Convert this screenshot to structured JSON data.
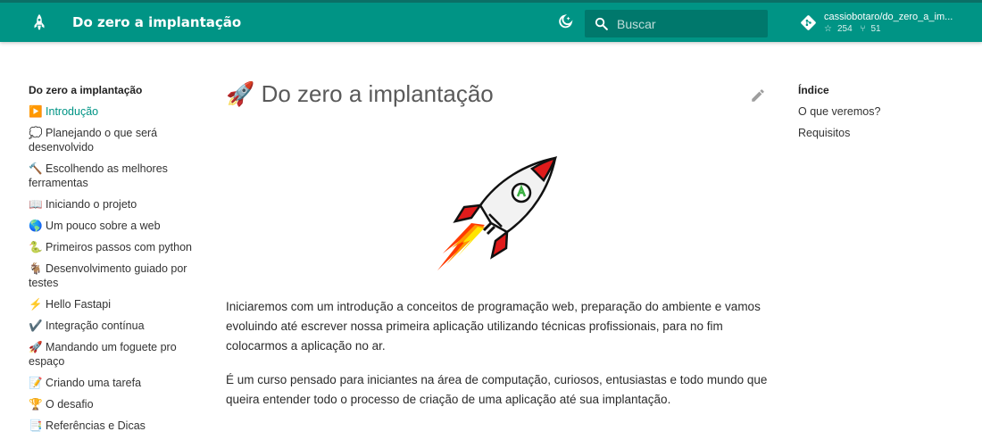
{
  "header": {
    "site_title": "Do zero a implantação",
    "theme_toggle_icon": "theme-toggle-icon",
    "search_placeholder": "Buscar",
    "repo": {
      "name": "cassiobotaro/do_zero_a_im...",
      "stars": "254",
      "forks": "51"
    }
  },
  "nav": {
    "title": "Do zero a implantação",
    "items": [
      {
        "label": "▶️ Introdução",
        "active": true
      },
      {
        "label": "💭 Planejando o que será desenvolvido"
      },
      {
        "label": "🔨 Escolhendo as melhores ferramentas"
      },
      {
        "label": "📖 Iniciando o projeto"
      },
      {
        "label": "🌎 Um pouco sobre a web"
      },
      {
        "label": "🐍 Primeiros passos com python"
      },
      {
        "label": "🐐 Desenvolvimento guiado por testes"
      },
      {
        "label": "⚡ Hello Fastapi"
      },
      {
        "label": "✔️ Integração contínua"
      },
      {
        "label": "🚀 Mandando um foguete pro espaço"
      },
      {
        "label": "📝 Criando uma tarefa"
      },
      {
        "label": "🏆 O desafio"
      },
      {
        "label": "📑 Referências e Dicas"
      }
    ]
  },
  "main": {
    "title": "🚀 Do zero a implantação",
    "paragraphs": [
      "Iniciaremos com um introdução a conceitos de programação web, preparação do ambiente e vamos evoluindo até escrever nossa primeira aplicação utilizando técnicas profissionais, para no fim colocarmos a aplicação no ar.",
      "É um curso pensado para iniciantes na área de computação, curiosos, entusiastas e todo mundo que queira entender todo o processo de criação de uma aplicação até sua implantação."
    ]
  },
  "toc": {
    "title": "Índice",
    "items": [
      "O que veremos?",
      "Requisitos"
    ]
  },
  "colors": {
    "primary": "#009485",
    "search_bg": "#00786c",
    "active_link": "#009485"
  }
}
